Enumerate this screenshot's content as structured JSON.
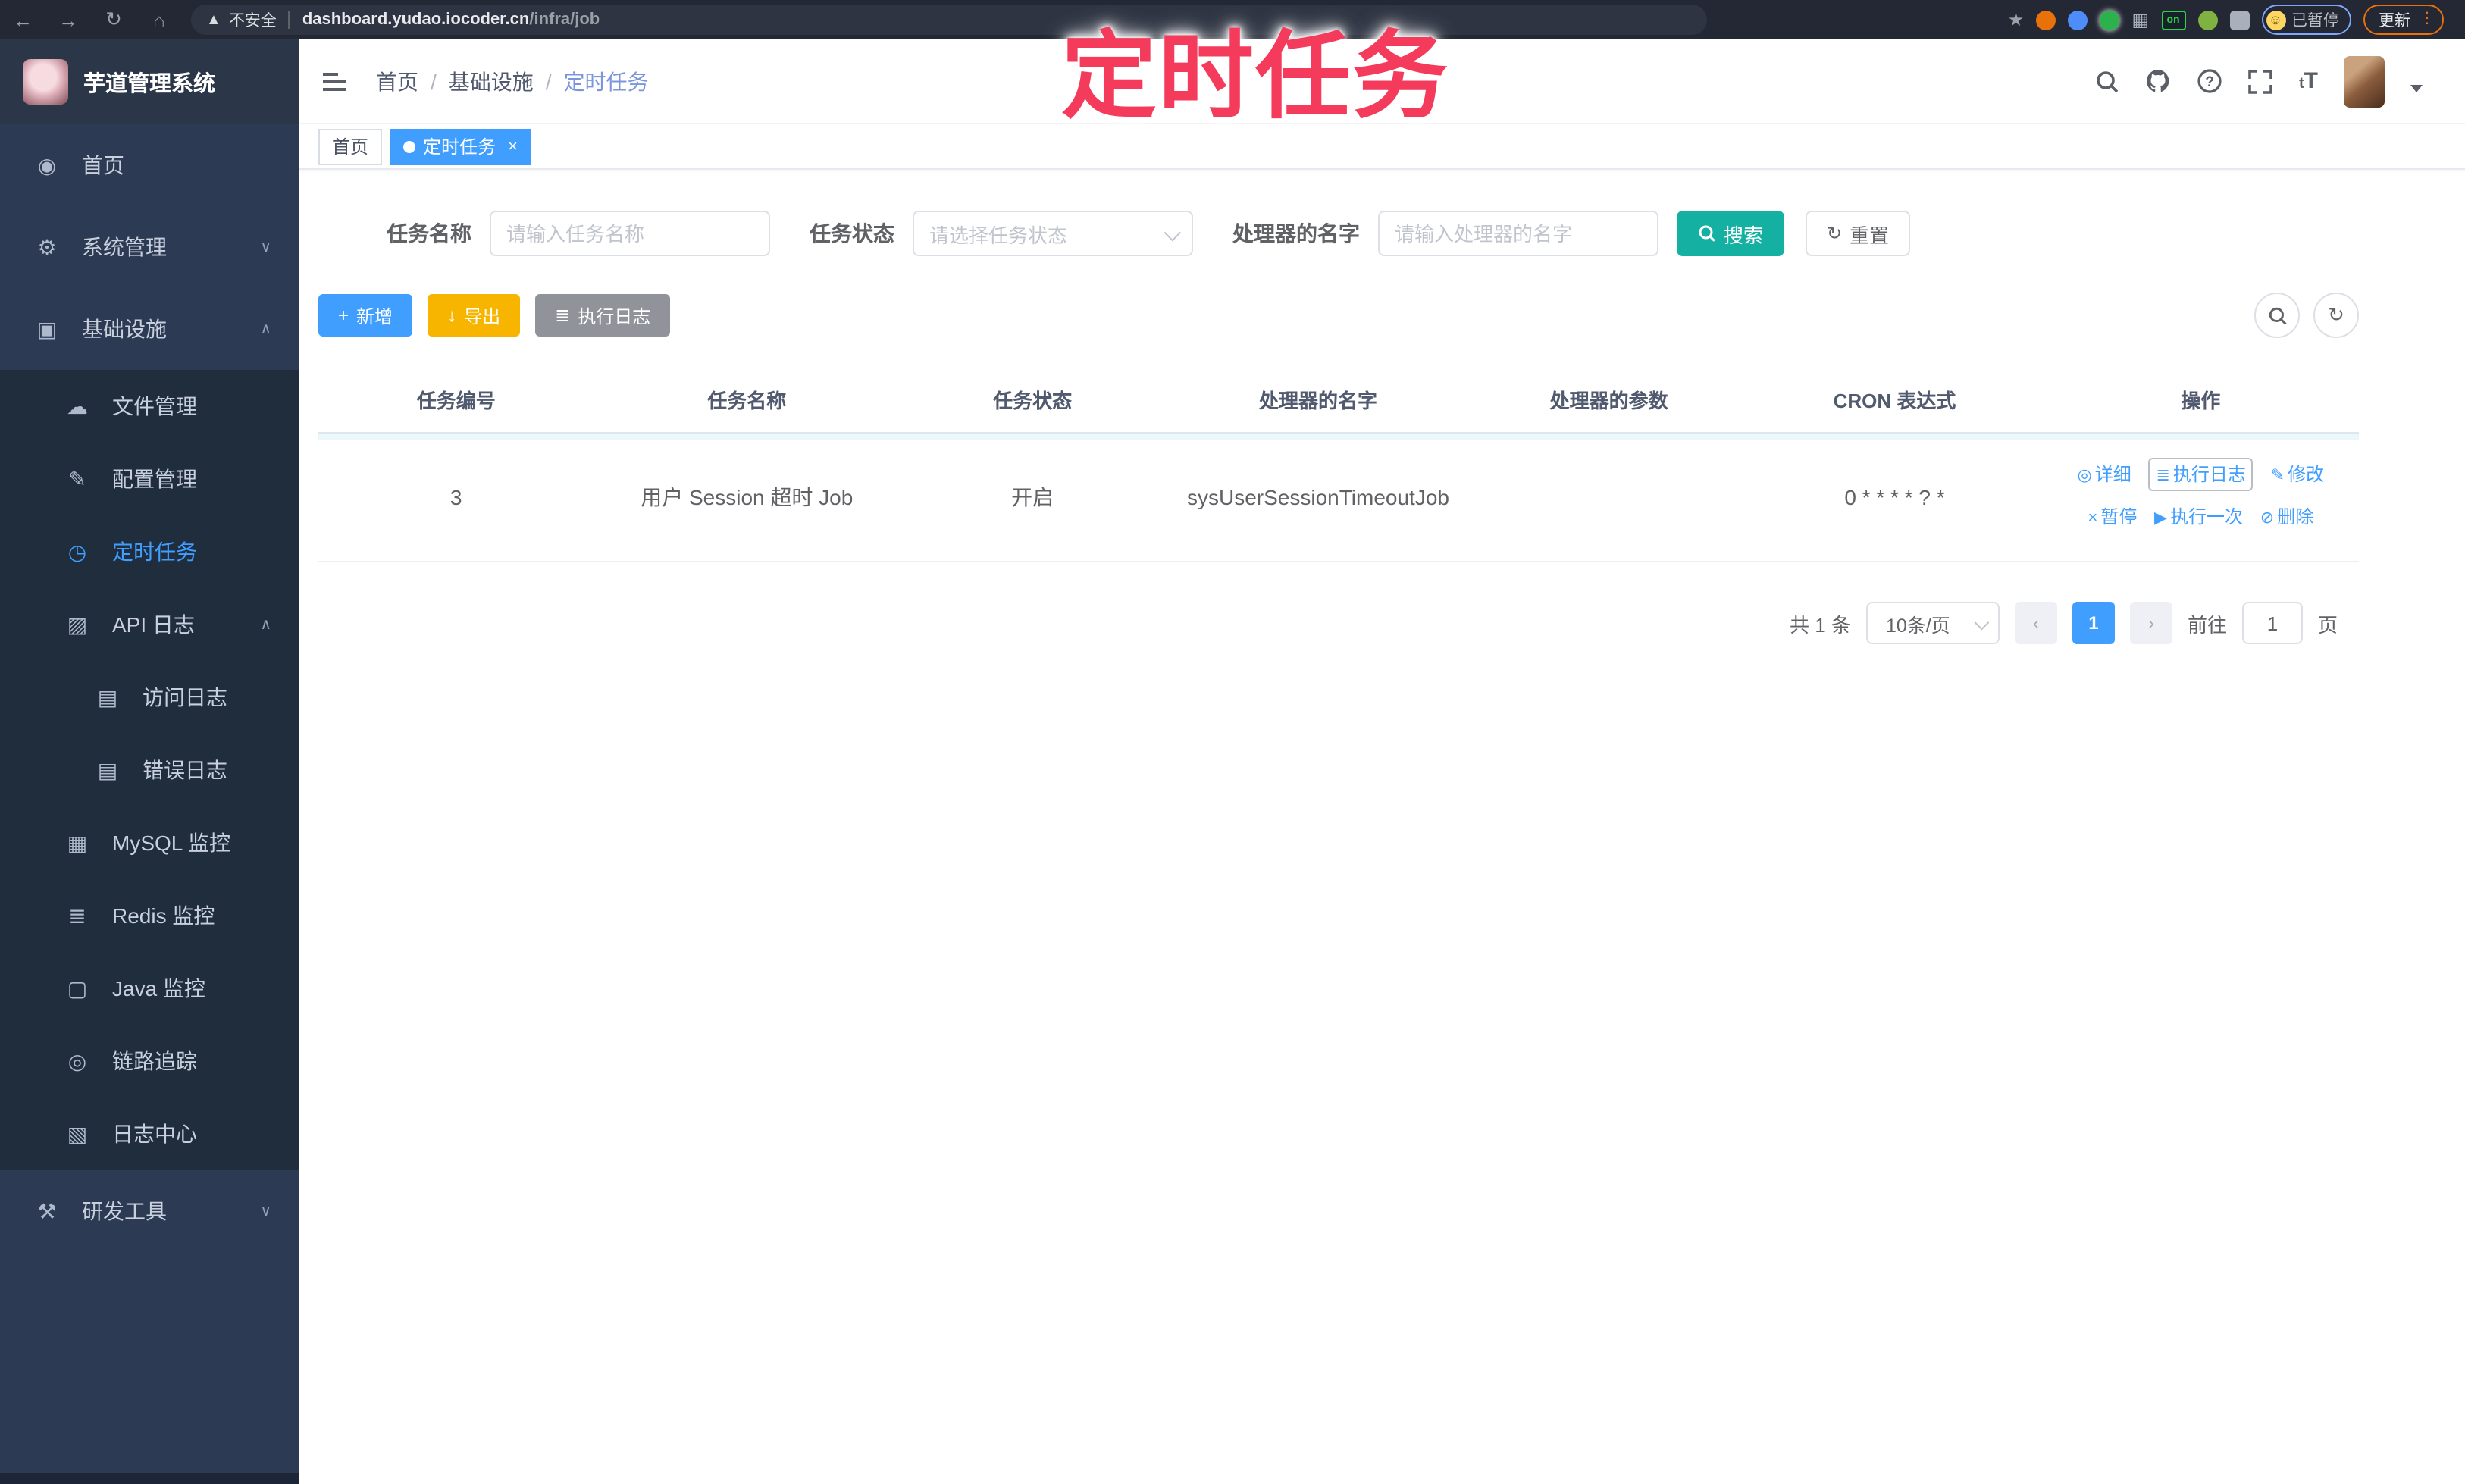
{
  "browser": {
    "security": "不安全",
    "host": "dashboard.yudao.iocoder.cn",
    "path": "/infra/job",
    "profile_chip": "已暂停",
    "update_button": "更新"
  },
  "annotation": {
    "text": "定时任务",
    "color": "#f43b5c"
  },
  "sidebar": {
    "title": "芋道管理系统",
    "menu": [
      {
        "label": "首页"
      },
      {
        "label": "系统管理"
      },
      {
        "label": "基础设施"
      },
      {
        "label": "文件管理"
      },
      {
        "label": "配置管理"
      },
      {
        "label": "定时任务"
      },
      {
        "label": "API 日志"
      },
      {
        "label": "访问日志"
      },
      {
        "label": "错误日志"
      },
      {
        "label": "MySQL 监控"
      },
      {
        "label": "Redis 监控"
      },
      {
        "label": "Java 监控"
      },
      {
        "label": "链路追踪"
      },
      {
        "label": "日志中心"
      },
      {
        "label": "研发工具"
      }
    ]
  },
  "breadcrumb": {
    "items": [
      "首页",
      "基础设施",
      "定时任务"
    ]
  },
  "tabs": [
    {
      "label": "首页"
    },
    {
      "label": "定时任务"
    }
  ],
  "filters": {
    "name_label": "任务名称",
    "name_placeholder": "请输入任务名称",
    "status_label": "任务状态",
    "status_placeholder": "请选择任务状态",
    "handler_label": "处理器的名字",
    "handler_placeholder": "请输入处理器的名字",
    "search_button": "搜索",
    "reset_button": "重置"
  },
  "toolbar": {
    "add": "新增",
    "export": "导出",
    "exec_log": "执行日志"
  },
  "table": {
    "columns": [
      "任务编号",
      "任务名称",
      "任务状态",
      "处理器的名字",
      "处理器的参数",
      "CRON 表达式",
      "操作"
    ],
    "row": {
      "id": "3",
      "name": "用户 Session 超时 Job",
      "status": "开启",
      "handler": "sysUserSessionTimeoutJob",
      "param": "",
      "cron": "0 * * * * ? *"
    },
    "actions": [
      "详细",
      "执行日志",
      "修改",
      "暂停",
      "执行一次",
      "删除"
    ]
  },
  "pagination": {
    "total": "共 1 条",
    "page_size": "10条/页",
    "current_page": "1",
    "goto_label": "前往",
    "goto_value": "1",
    "page_unit": "页"
  },
  "colors": {
    "accent_blue": "#409eff",
    "search_teal": "#14b1a2",
    "export_yellow": "#f7b500",
    "info_gray": "#909399",
    "sidebar_bg": "#2d3a53",
    "submenu_bg": "#1f2d3d",
    "annotation_pink": "#f43b5c"
  }
}
